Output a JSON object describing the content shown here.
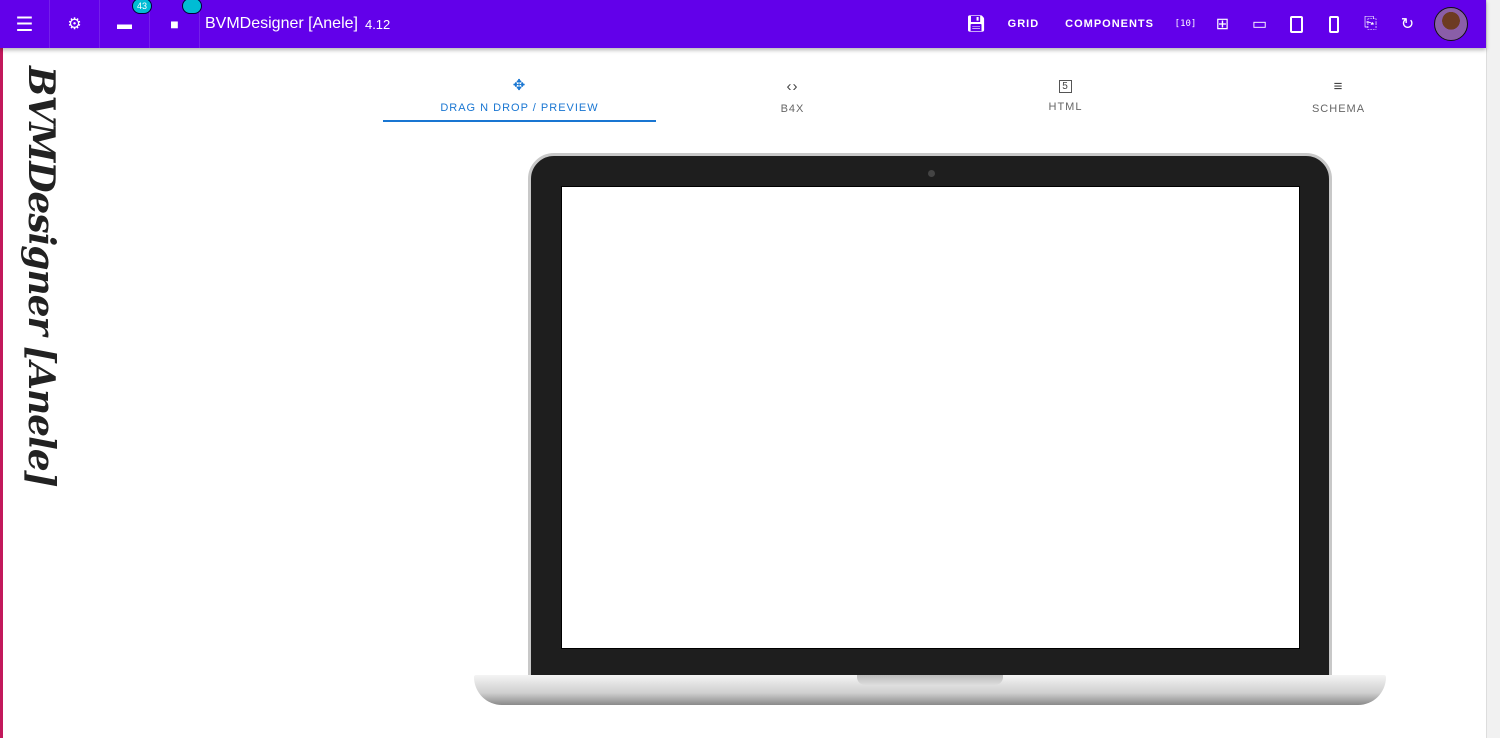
{
  "header": {
    "title": "BVMDesigner [Anele]",
    "version": "4.12",
    "badge_count": "43",
    "grid_label": "GRID",
    "components_label": "COMPONENTS"
  },
  "side_title": "BVMDesigner [Anele]",
  "tabs": [
    {
      "label": "DRAG N DROP / PREVIEW",
      "icon": "✥"
    },
    {
      "label": "B4X",
      "icon": "‹›"
    },
    {
      "label": "HTML",
      "icon": "5"
    },
    {
      "label": "SCHEMA",
      "icon": "≡"
    }
  ],
  "colors": {
    "appbar": "#6200ea",
    "accent": "#1976d2",
    "badge": "#00bcd4"
  }
}
